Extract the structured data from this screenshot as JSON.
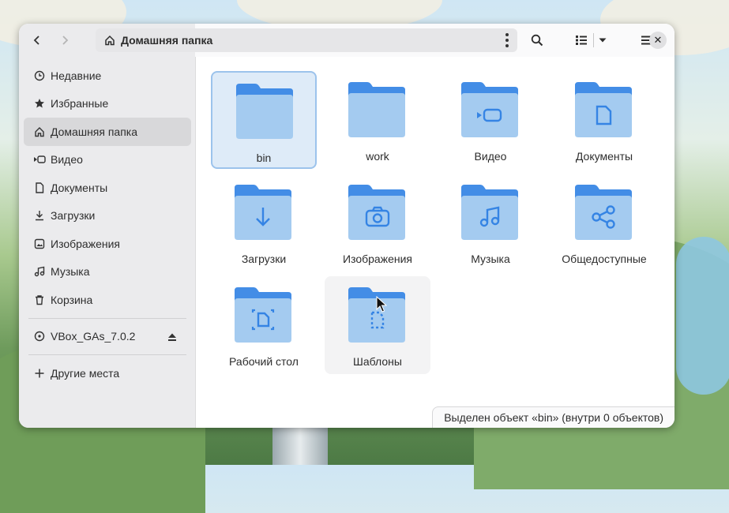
{
  "window": {
    "location_title": "Домашняя папка",
    "status_text": "Выделен объект «bin» (внутри 0 объектов)"
  },
  "sidebar": {
    "items": [
      {
        "label": "Недавние",
        "icon": "clock-icon"
      },
      {
        "label": "Избранные",
        "icon": "star-icon"
      },
      {
        "label": "Домашняя папка",
        "icon": "home-icon",
        "active": true
      },
      {
        "label": "Видео",
        "icon": "video-icon"
      },
      {
        "label": "Документы",
        "icon": "document-icon"
      },
      {
        "label": "Загрузки",
        "icon": "download-icon"
      },
      {
        "label": "Изображения",
        "icon": "image-icon"
      },
      {
        "label": "Музыка",
        "icon": "music-icon"
      },
      {
        "label": "Корзина",
        "icon": "trash-icon"
      }
    ],
    "devices": [
      {
        "label": "VBox_GAs_7.0.2",
        "icon": "disc-icon",
        "action_icon": "eject-icon"
      }
    ],
    "other": {
      "label": "Другие места",
      "icon": "plus-icon"
    }
  },
  "files": [
    {
      "name": "bin",
      "emblem": "none",
      "selected": true
    },
    {
      "name": "work",
      "emblem": "none"
    },
    {
      "name": "Видео",
      "emblem": "video"
    },
    {
      "name": "Документы",
      "emblem": "document"
    },
    {
      "name": "Загрузки",
      "emblem": "download"
    },
    {
      "name": "Изображения",
      "emblem": "camera"
    },
    {
      "name": "Музыка",
      "emblem": "music"
    },
    {
      "name": "Общедоступные",
      "emblem": "share"
    },
    {
      "name": "Рабочий стол",
      "emblem": "desktop"
    },
    {
      "name": "Шаблоны",
      "emblem": "template",
      "hovered": true
    }
  ],
  "colors": {
    "accent": "#3584e4",
    "folder_back": "#438de6",
    "folder_front": "#a4cbf0",
    "selection": "#deebf8"
  }
}
